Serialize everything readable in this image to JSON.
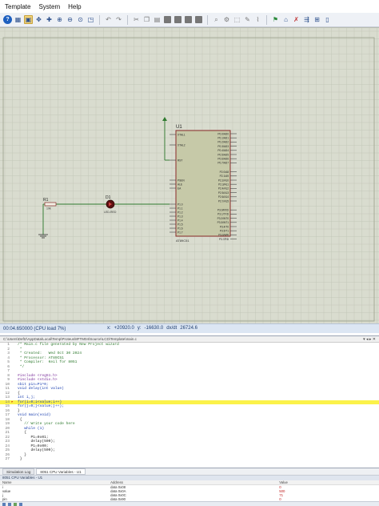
{
  "menubar": {
    "items": [
      "Template",
      "System",
      "Help"
    ]
  },
  "toolbar": {
    "icons": [
      {
        "name": "help-icon",
        "glyph": "?",
        "cls": "help"
      },
      {
        "name": "library-icon",
        "glyph": "▦",
        "cls": ""
      },
      {
        "name": "component-mode-icon",
        "glyph": "▣",
        "cls": "sel"
      },
      {
        "name": "move-icon",
        "glyph": "✥",
        "cls": ""
      },
      {
        "name": "pan-icon",
        "glyph": "✚",
        "cls": ""
      },
      {
        "name": "zoom-in-icon",
        "glyph": "⊕",
        "cls": ""
      },
      {
        "name": "zoom-out-icon",
        "glyph": "⊖",
        "cls": ""
      },
      {
        "name": "zoom-all-icon",
        "glyph": "⊙",
        "cls": ""
      },
      {
        "name": "zoom-area-icon",
        "glyph": "◳",
        "cls": ""
      },
      {
        "name": "sep",
        "glyph": "",
        "cls": "sep"
      },
      {
        "name": "undo-icon",
        "glyph": "↶",
        "cls": "gray"
      },
      {
        "name": "redo-icon",
        "glyph": "↷",
        "cls": "gray"
      },
      {
        "name": "sep",
        "glyph": "",
        "cls": "sep"
      },
      {
        "name": "cut-icon",
        "glyph": "✂",
        "cls": "gray"
      },
      {
        "name": "copy-icon",
        "glyph": "❐",
        "cls": "gray"
      },
      {
        "name": "paste-icon",
        "glyph": "▤",
        "cls": "gray"
      },
      {
        "name": "block-copy-icon",
        "glyph": "",
        "cls": "blk"
      },
      {
        "name": "block-move-icon",
        "glyph": "",
        "cls": "blk"
      },
      {
        "name": "block-rotate-icon",
        "glyph": "",
        "cls": "blk"
      },
      {
        "name": "block-delete-icon",
        "glyph": "",
        "cls": "blk"
      },
      {
        "name": "sep",
        "glyph": "",
        "cls": "sep"
      },
      {
        "name": "pick-device-icon",
        "glyph": "⌕",
        "cls": "gray"
      },
      {
        "name": "make-device-icon",
        "glyph": "⚙",
        "cls": "gray"
      },
      {
        "name": "package-icon",
        "glyph": "⬚",
        "cls": "gray"
      },
      {
        "name": "decompose-icon",
        "glyph": "✎",
        "cls": "gray"
      },
      {
        "name": "wire-autoroute-icon",
        "glyph": "⌇",
        "cls": "gray"
      },
      {
        "name": "sep",
        "glyph": "",
        "cls": "sep"
      },
      {
        "name": "design-explorer-icon",
        "glyph": "⚑",
        "cls": "green"
      },
      {
        "name": "property-tool-icon",
        "glyph": "⌂",
        "cls": ""
      },
      {
        "name": "electrical-rules-icon",
        "glyph": "✗",
        "cls": "red"
      },
      {
        "name": "netlist-icon",
        "glyph": "⇶",
        "cls": ""
      },
      {
        "name": "bill-of-materials-icon",
        "glyph": "⊞",
        "cls": ""
      },
      {
        "name": "pdf-export-icon",
        "glyph": "▯",
        "cls": ""
      }
    ]
  },
  "schematic": {
    "u1_ref": "U1",
    "u1_part": "AT89C51",
    "u1_left_pins": [
      "XTAL1",
      "XTAL2",
      "RST",
      "PSEN",
      "ALE",
      "EA",
      "P1.0",
      "P1.1",
      "P1.2",
      "P1.3",
      "P1.4",
      "P1.5",
      "P1.6",
      "P1.7"
    ],
    "u1_right_pins": [
      "P0.0/AD0",
      "P0.1/AD1",
      "P0.2/AD2",
      "P0.3/AD3",
      "P0.4/AD4",
      "P0.5/AD5",
      "P0.6/AD6",
      "P0.7/AD7",
      "P2.0/A8",
      "P2.1/A9",
      "P2.2/A10",
      "P2.3/A11",
      "P2.4/A12",
      "P2.5/A13",
      "P2.6/A14",
      "P2.7/A15",
      "P3.0/RXD",
      "P3.1/TXD",
      "P3.2/INT0",
      "P3.3/INT1",
      "P3.4/T0",
      "P3.5/T1",
      "P3.6/WR",
      "P3.7/RD"
    ],
    "r1_ref": "R1",
    "r1_value": "10k",
    "d1_ref": "D1",
    "d1_part": "LED-RED"
  },
  "status": {
    "time": "00:04.650000 (CPU load 7%)",
    "x_label": "x:",
    "x_value": "+20920.0",
    "y_label": "y:",
    "y_value": "-16630.0",
    "dxdt_label": "dx/dt",
    "dxdt_value": "26724.6"
  },
  "editor": {
    "path": "C:\\Users\\Deftz\\AppData\\Local\\Temp\\Proteus\\8FTM04\\Source\\LCD\\Template\\main.c",
    "controls": "▾ ◂ ▸ ✕",
    "lines": [
      {
        "n": "1",
        "t": "/* Main.c file generated by New Project wizard",
        "c": "c-comment"
      },
      {
        "n": "2",
        "t": " *",
        "c": "c-comment"
      },
      {
        "n": "3",
        "t": " * Created:   Wed Oct 30 2024",
        "c": "c-comment"
      },
      {
        "n": "4",
        "t": " * Processor: AT89C51",
        "c": "c-comment"
      },
      {
        "n": "5",
        "t": " * Compiler:  Keil for 8051",
        "c": "c-comment"
      },
      {
        "n": "6",
        "t": " */",
        "c": "c-comment"
      },
      {
        "n": "7",
        "t": "",
        "c": "c-txt"
      },
      {
        "n": "8",
        "t": "#include <reg51.h>",
        "c": "c-pre"
      },
      {
        "n": "9",
        "t": "#include <stdio.h>",
        "c": "c-pre"
      },
      {
        "n": "10",
        "t": "sbit pin=P1^0;",
        "c": "c-kw"
      },
      {
        "n": "11",
        "t": "void delay(int value)",
        "c": "c-kw"
      },
      {
        "n": "12",
        "t": "{",
        "c": "c-txt"
      },
      {
        "n": "13",
        "t": "int i,j;",
        "c": "c-kw"
      },
      {
        "n": "14",
        "t": "for(i=0;i<value;i++)",
        "c": "c-kw",
        "hl": true
      },
      {
        "n": "15",
        "t": "for(j=0;j<value;j++);",
        "c": "c-kw"
      },
      {
        "n": "16",
        "t": "}",
        "c": "c-txt"
      },
      {
        "n": "17",
        "t": "void main(void)",
        "c": "c-kw"
      },
      {
        "n": "18",
        "t": " {",
        "c": "c-txt"
      },
      {
        "n": "19",
        "t": "   // Write your code here",
        "c": "c-comment"
      },
      {
        "n": "20",
        "t": "   while (1)",
        "c": "c-kw"
      },
      {
        "n": "21",
        "t": "   {",
        "c": "c-txt"
      },
      {
        "n": "22",
        "t": "      P1=0x01;",
        "c": "c-txt"
      },
      {
        "n": "23",
        "t": "      delay(500);",
        "c": "c-txt"
      },
      {
        "n": "24",
        "t": "      P1=0x00;",
        "c": "c-txt"
      },
      {
        "n": "25",
        "t": "      delay(500);",
        "c": "c-txt"
      },
      {
        "n": "26",
        "t": "   }",
        "c": "c-txt"
      },
      {
        "n": "27",
        "t": " }",
        "c": "c-txt"
      }
    ]
  },
  "tabs": [
    "Simulation Log",
    "8051 CPU Variables - U1"
  ],
  "watch": {
    "title": "8051 CPU Variables - U1",
    "headers": [
      "Name",
      "Address",
      "Value"
    ],
    "rows": [
      {
        "name": "i",
        "address": "data 0x08",
        "value": "0"
      },
      {
        "name": "value",
        "address": "data 0x0A",
        "value": "500"
      },
      {
        "name": "j",
        "address": "data 0x0C",
        "value": "71"
      },
      {
        "name": "pin",
        "address": "data 0x90",
        "value": "0"
      }
    ]
  },
  "colors": {
    "grid_bg": "#d9dccf",
    "grid_line": "#c3c7b8",
    "chip_fill": "#c6c9a8",
    "chip_border": "#8a2a2a",
    "wire": "#2f7a2f",
    "highlight": "#fbf24a"
  }
}
